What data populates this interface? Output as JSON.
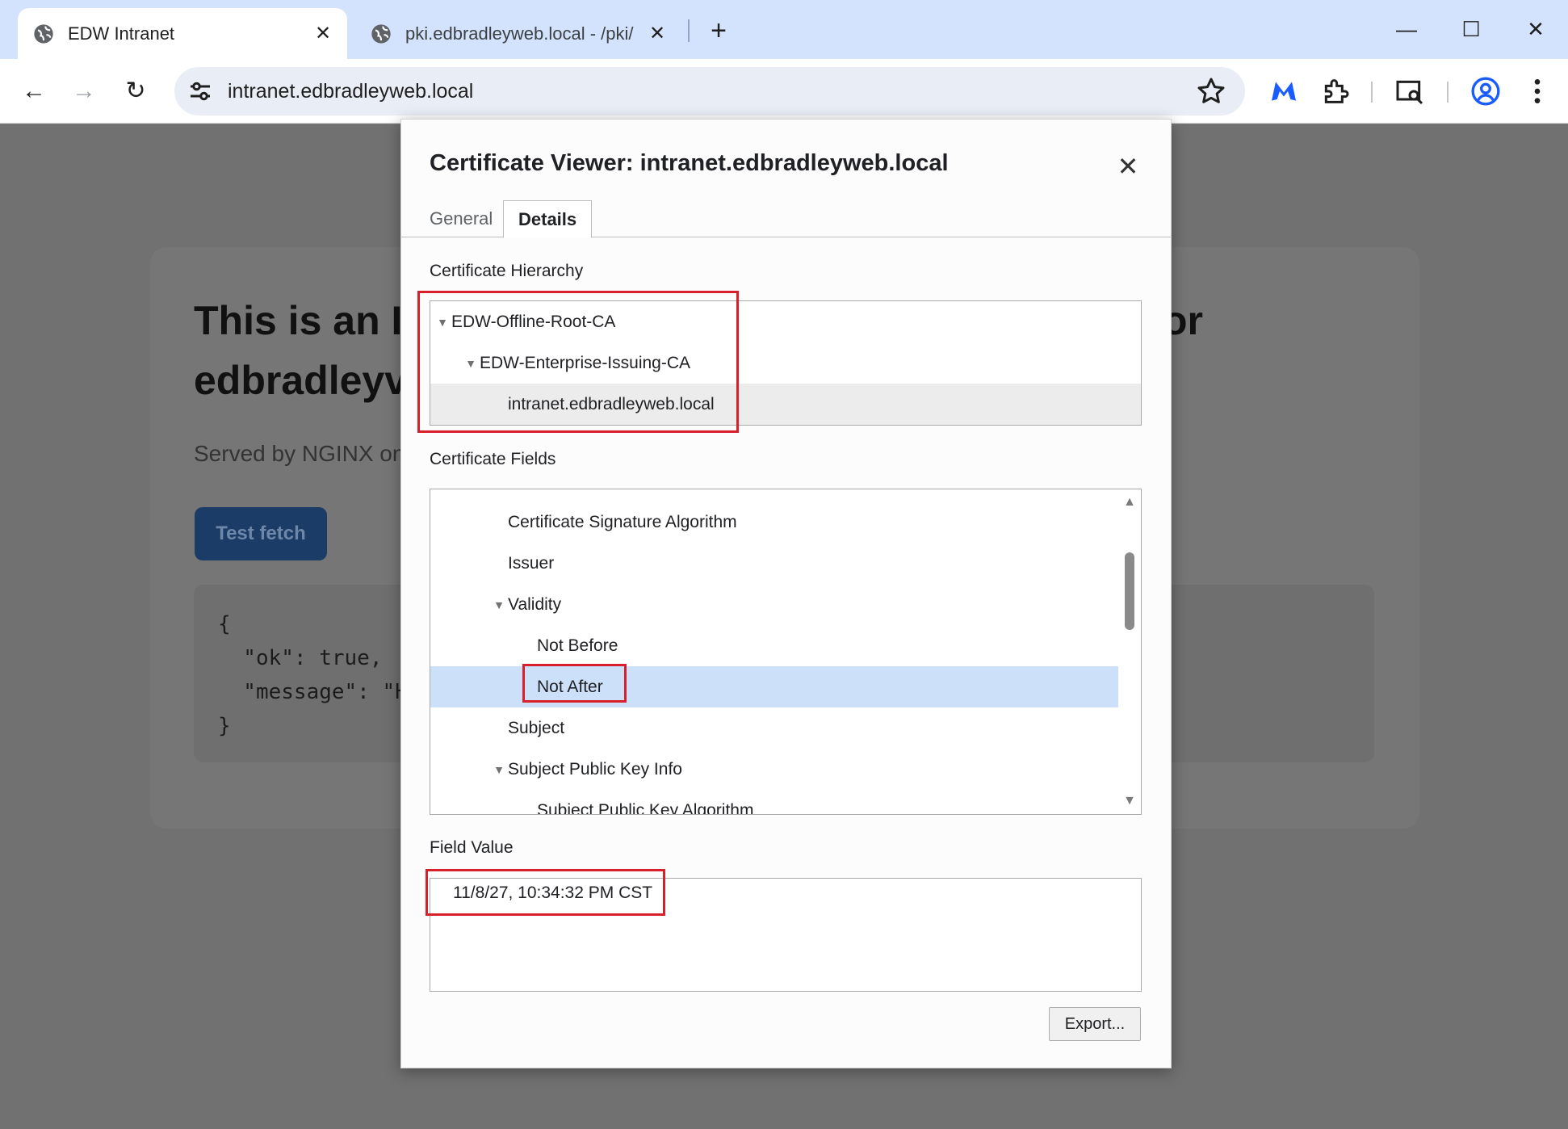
{
  "browser": {
    "tabs": [
      {
        "title": "EDW Intranet",
        "active": true
      },
      {
        "title": "pki.edbradleyweb.local - /pki/",
        "active": false
      }
    ],
    "url": "intranet.edbradleyweb.local",
    "icons": [
      "back-icon",
      "forward-icon",
      "reload-icon",
      "site-info-icon",
      "bookmark-star-icon",
      "malwarebytes-icon",
      "extensions-icon",
      "tab-search-icon",
      "profile-icon",
      "menu-icon"
    ],
    "accent": "#d3e3fd"
  },
  "page": {
    "headline_line1_visible": "This is an I",
    "headline_line1_right": "or",
    "headline_line2_visible": "edbradleyv",
    "served_by": "Served by NGINX on",
    "test_button": "Test fetch",
    "code_lines": [
      "{",
      "  \"ok\": true,",
      "  \"message\": \"H",
      "}"
    ]
  },
  "dialog": {
    "title": "Certificate Viewer: intranet.edbradleyweb.local",
    "tabs": {
      "general": "General",
      "details": "Details"
    },
    "hierarchy_label": "Certificate Hierarchy",
    "hierarchy": [
      {
        "label": "EDW-Offline-Root-CA",
        "level": 0,
        "expanded": true
      },
      {
        "label": "EDW-Enterprise-Issuing-CA",
        "level": 1,
        "expanded": true
      },
      {
        "label": "intranet.edbradleyweb.local",
        "level": 2,
        "selected": true
      }
    ],
    "fields_label": "Certificate Fields",
    "fields": [
      {
        "label": "Certificate Signature Algorithm"
      },
      {
        "label": "Issuer"
      },
      {
        "label": "Validity",
        "expanded": true
      },
      {
        "label": "Not Before"
      },
      {
        "label": "Not After",
        "selected": true
      },
      {
        "label": "Subject"
      },
      {
        "label": "Subject Public Key Info",
        "expanded": true
      },
      {
        "label": "Subject Public Key Algorithm"
      }
    ],
    "value_label": "Field Value",
    "field_value": "11/8/27, 10:34:32 PM CST",
    "export_button": "Export...",
    "annotation_color": "#d8202a",
    "selection_color": "#cce0fa"
  }
}
